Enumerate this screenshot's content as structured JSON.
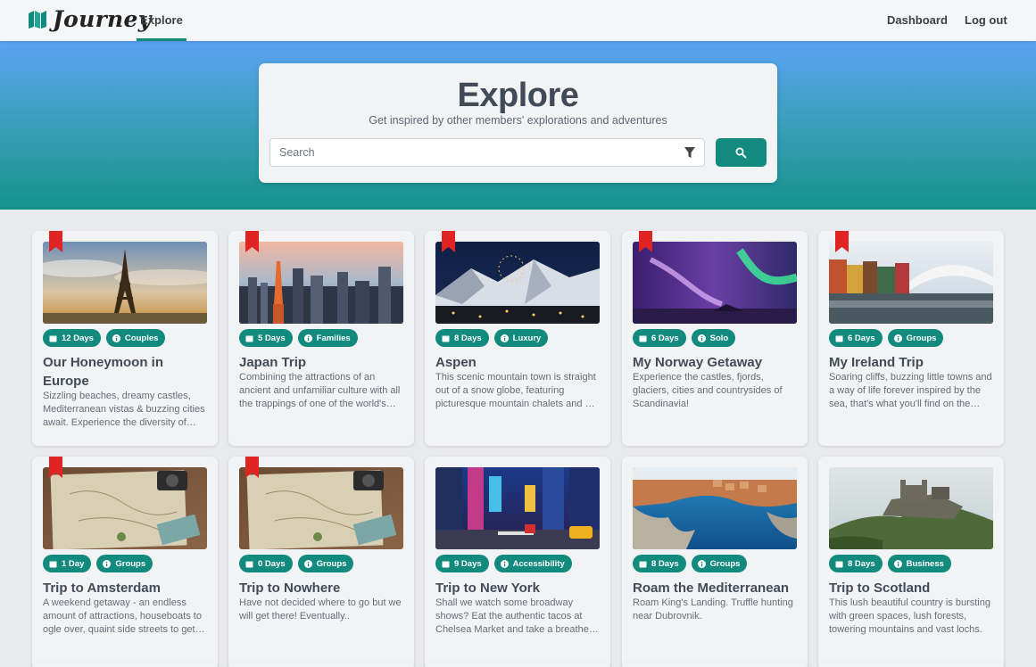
{
  "nav": {
    "logo_text": "Journey",
    "explore": "Explore",
    "dashboard": "Dashboard",
    "logout": "Log out"
  },
  "hero": {
    "title": "Explore",
    "subtitle": "Get inspired by other members' explorations and adventures",
    "search_placeholder": "Search"
  },
  "colors": {
    "accent": "#138a7e",
    "bookmark": "#e02424",
    "hero_top": "#5aa3f2",
    "hero_bottom": "#14938a"
  },
  "cards": [
    {
      "title": "Our Honeymoon in Europe",
      "days": "12 Days",
      "category": "Couples",
      "bookmarked": true,
      "description": "Sizzling beaches, dreamy castles, Mediterranean vistas & buzzing cities await. Experience the diversity of Europe's regions."
    },
    {
      "title": "Japan Trip",
      "days": "5 Days",
      "category": "Families",
      "bookmarked": true,
      "description": "Combining the attractions of an ancient and unfamiliar culture with all the trappings of one of the world's most modern societies."
    },
    {
      "title": "Aspen",
      "days": "8 Days",
      "category": "Luxury",
      "bookmarked": true,
      "description": "This scenic mountain town is straight out of a snow globe, featuring picturesque mountain chalets and ski runs."
    },
    {
      "title": "My Norway Getaway",
      "days": "6 Days",
      "category": "Solo",
      "bookmarked": true,
      "description": "Experience the castles, fjords, glaciers, cities and countrysides of Scandinavia!"
    },
    {
      "title": "My Ireland Trip",
      "days": "6 Days",
      "category": "Groups",
      "bookmarked": true,
      "description": "Soaring cliffs, buzzing little towns and a way of life forever inspired by the sea, that's what you'll find on the island."
    },
    {
      "title": "Trip to Amsterdam",
      "days": "1 Day",
      "category": "Groups",
      "bookmarked": true,
      "description": "A weekend getaway - an endless amount of attractions, houseboats to ogle over, quaint side streets to get lost in."
    },
    {
      "title": "Trip to Nowhere",
      "days": "0 Days",
      "category": "Groups",
      "bookmarked": true,
      "description": "Have not decided where to go but we will get there! Eventually.."
    },
    {
      "title": "Trip to New York",
      "days": "9 Days",
      "category": "Accessibility",
      "bookmarked": false,
      "description": "Shall we watch some broadway shows? Eat the authentic tacos at Chelsea Market and take a breather in Central Park."
    },
    {
      "title": "Roam the Mediterranean",
      "days": "8 Days",
      "category": "Groups",
      "bookmarked": false,
      "description": "Roam King's Landing. Truffle hunting near Dubrovnik."
    },
    {
      "title": "Trip to Scotland",
      "days": "8 Days",
      "category": "Business",
      "bookmarked": false,
      "description": "This lush beautiful country is bursting with green spaces, lush forests, towering mountains and vast lochs."
    }
  ]
}
